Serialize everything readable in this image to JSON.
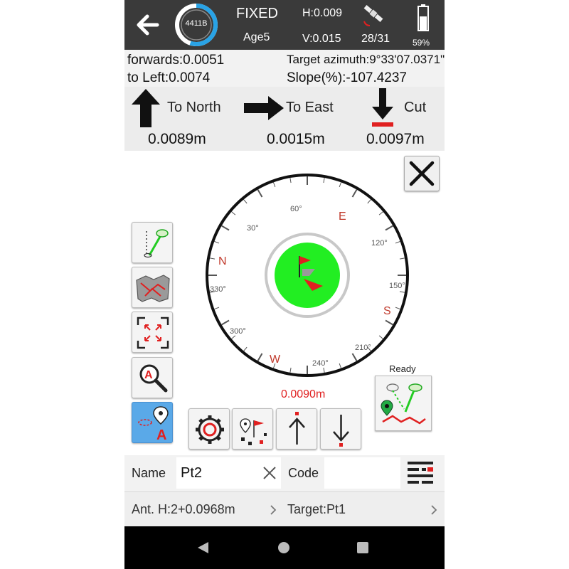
{
  "status": {
    "ring_label": "4411B",
    "fix_status": "FIXED",
    "age": "Age5",
    "h_precision": "H:0.009",
    "v_precision": "V:0.015",
    "satellites": "28/31",
    "battery": "59%",
    "ring_fill": 0.55,
    "battery_level": 0.59
  },
  "info": {
    "forwards": "forwards:0.0051",
    "to_left": "to Left:0.0074",
    "target_azimuth": "Target azimuth:9°33'07.0371\"",
    "slope": "Slope(%):-107.4237"
  },
  "directions": {
    "north_label": "To North",
    "north_value": "0.0089m",
    "east_label": "To East",
    "east_value": "0.0015m",
    "cut_label": "Cut",
    "cut_value": "0.0097m"
  },
  "compass": {
    "cardinals": [
      "N",
      "E",
      "S",
      "W"
    ],
    "degree_labels": [
      "30°",
      "60°",
      "120°",
      "150°",
      "210°",
      "240°",
      "300°",
      "330°"
    ],
    "distance": "0.0090m"
  },
  "ready_label": "Ready",
  "name_field": {
    "label": "Name",
    "value": "Pt2"
  },
  "code_field": {
    "label": "Code",
    "value": ""
  },
  "bottom": {
    "antenna": "Ant. H:2+0.0968m",
    "target": "Target:Pt1"
  },
  "colors": {
    "header_bg": "#3a3a3a",
    "accent_blue": "#29a3e6",
    "target_green": "#22ee22",
    "alert_red": "#e02020"
  }
}
